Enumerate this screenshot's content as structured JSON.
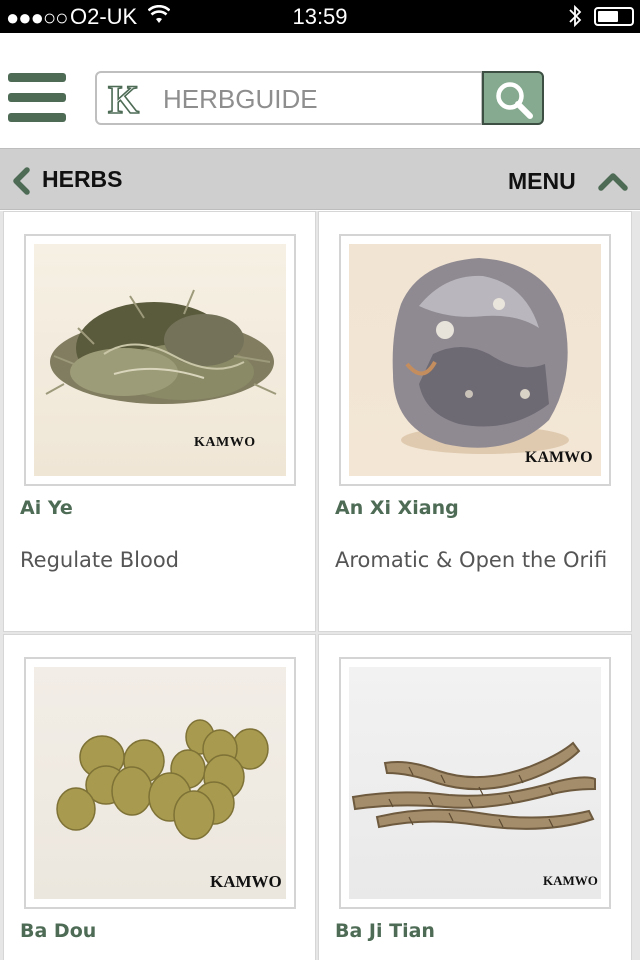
{
  "status_bar": {
    "signal": "●●●○○",
    "carrier": "O2-UK",
    "time": "13:59"
  },
  "header": {
    "search_placeholder": "HERBGUIDE",
    "logo_letter": "K"
  },
  "subnav": {
    "back_label": "HERBS",
    "menu_label": "MENU"
  },
  "herbs": [
    {
      "name": "Ai Ye",
      "description": "Regulate Blood",
      "watermark": "KAMWO"
    },
    {
      "name": "An Xi Xiang",
      "description": "Aromatic & Open the Orifi",
      "watermark": "KAMWO"
    },
    {
      "name": "Ba Dou",
      "description": "",
      "watermark": "KAMWO"
    },
    {
      "name": "Ba Ji Tian",
      "description": "",
      "watermark": "KAMWO"
    }
  ],
  "colors": {
    "brand_green": "#4d6b55",
    "search_button": "#85aa8f",
    "subnav_bg": "#cfcfcf"
  }
}
